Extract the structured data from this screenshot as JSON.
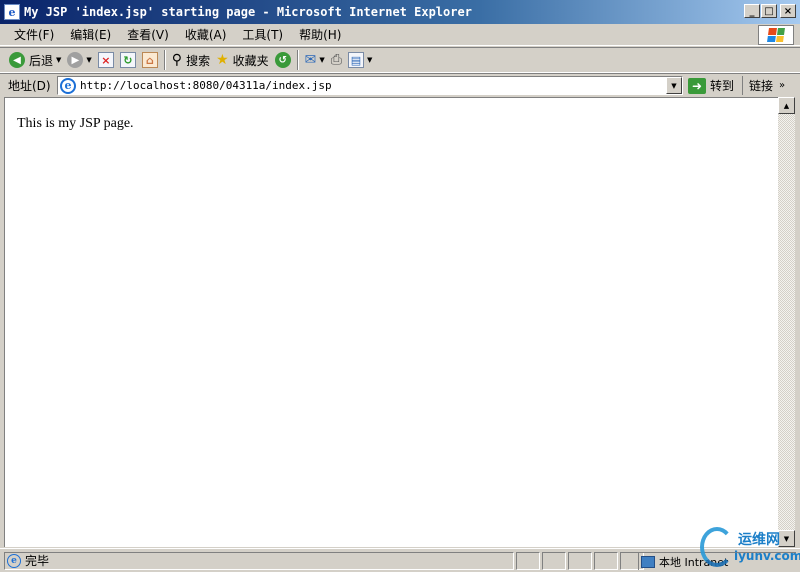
{
  "window": {
    "title": "My JSP 'index.jsp' starting page - Microsoft Internet Explorer",
    "controls": {
      "minimize": "_",
      "maximize": "□",
      "close": "×"
    }
  },
  "menu": {
    "items": [
      "文件(F)",
      "编辑(E)",
      "查看(V)",
      "收藏(A)",
      "工具(T)",
      "帮助(H)"
    ]
  },
  "toolbar": {
    "back_label": "后退",
    "search_label": "搜索",
    "favorites_label": "收藏夹"
  },
  "address": {
    "label": "地址(D)",
    "url": "http://localhost:8080/04311a/index.jsp",
    "go_label": "转到",
    "links_label": "链接"
  },
  "page": {
    "text": "This is my JSP page."
  },
  "status": {
    "text": "完毕",
    "zone": "本地 Intranet"
  },
  "watermark": {
    "name": "运维网",
    "url": "iyunv.com"
  },
  "icons": [
    "ie-icon",
    "windows-flag-icon",
    "back-icon",
    "forward-icon",
    "stop-icon",
    "refresh-icon",
    "home-icon",
    "search-icon",
    "favorites-icon",
    "history-icon",
    "mail-icon",
    "print-icon",
    "edit-icon",
    "go-icon",
    "page-icon",
    "zone-icon"
  ]
}
